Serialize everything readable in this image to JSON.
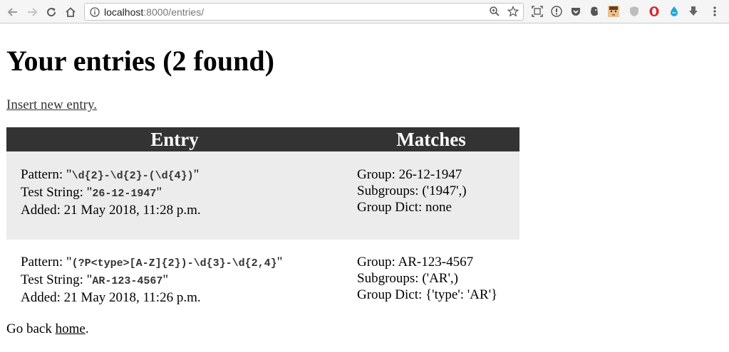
{
  "browser": {
    "url_host": "localhost",
    "url_path": ":8000/entries/"
  },
  "page": {
    "title": "Your entries (2 found)",
    "insert_link": "Insert new entry.",
    "table_headers": {
      "entry": "Entry",
      "matches": "Matches"
    },
    "entries": [
      {
        "pattern_label": "Pattern: ",
        "pattern": "\\d{2}-\\d{2}-(\\d{4})",
        "test_label": "Test String: ",
        "test_string": "26-12-1947",
        "added": "Added: 21 May 2018, 11:28 p.m.",
        "group": "Group: 26-12-1947",
        "subgroups": "Subgroups: ('1947',)",
        "group_dict": "Group Dict: none"
      },
      {
        "pattern_label": "Pattern: ",
        "pattern": "(?P<type>[A-Z]{2})-\\d{3}-\\d{2,4}",
        "test_label": "Test String: ",
        "test_string": "AR-123-4567",
        "added": "Added: 21 May 2018, 11:26 p.m.",
        "group": "Group: AR-123-4567",
        "subgroups": "Subgroups: ('AR',)",
        "group_dict": "Group Dict: {'type': 'AR'}"
      }
    ],
    "footer_prefix": "Go back ",
    "footer_link": "home",
    "footer_suffix": "."
  },
  "colors": {
    "header_bg": "#333333",
    "odd_row_bg": "#ececec"
  }
}
